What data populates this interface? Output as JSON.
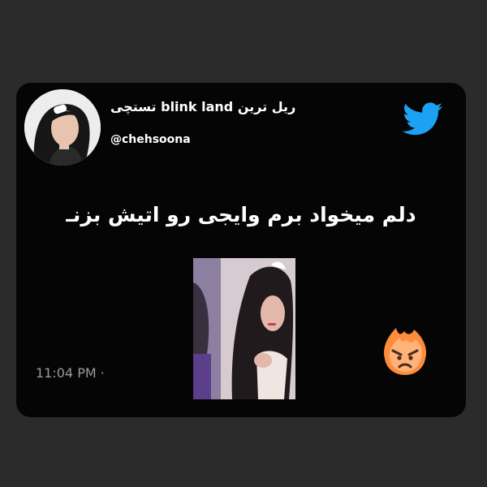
{
  "tweet": {
    "display_name": "ریل ترین blink land تستچی",
    "handle": "@chehsoona",
    "text": "دلم میخواد برم وایجی رو اتیش بزنـ",
    "timestamp": "11:04 PM ·"
  },
  "icons": {
    "brand": "twitter-bird-icon",
    "reaction": "angry-fire-emoji-icon"
  },
  "colors": {
    "background": "#2b2b2b",
    "card": "#050505",
    "twitter_blue": "#1da1f2",
    "timestamp_gray": "#9b9b9b"
  }
}
